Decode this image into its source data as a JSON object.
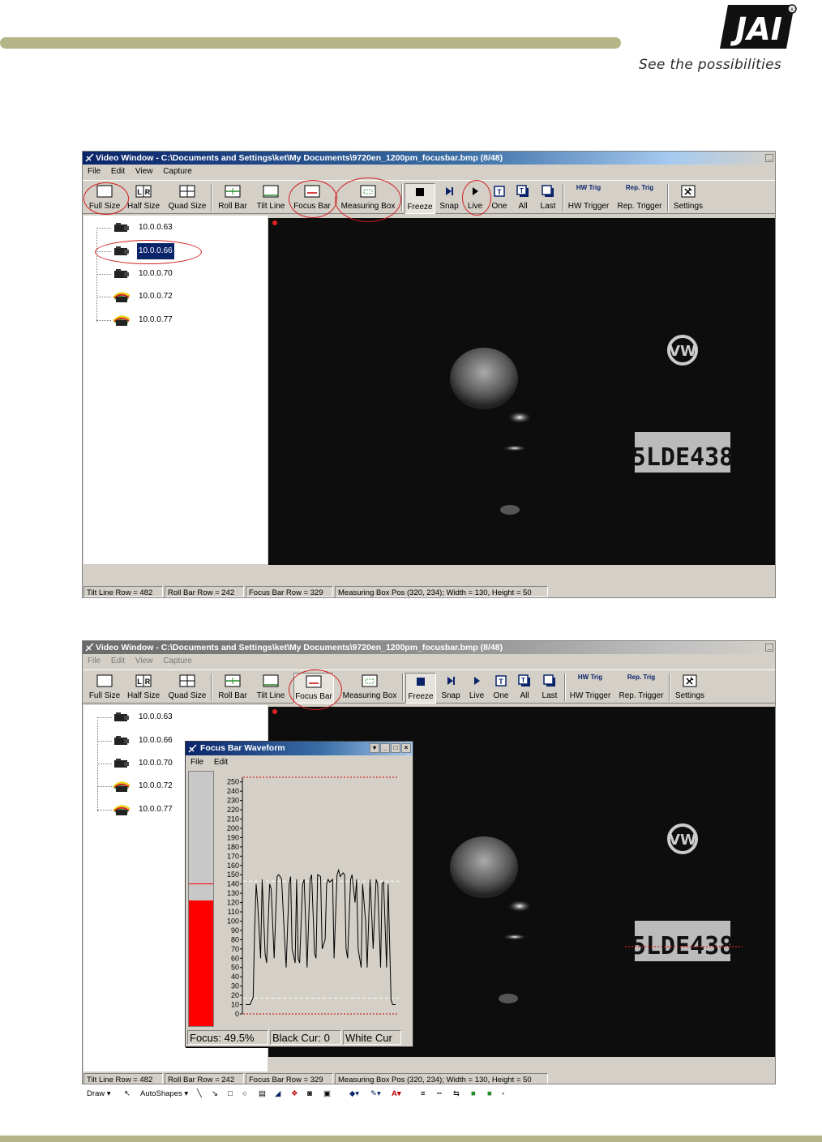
{
  "header": {
    "logo_text": "JAI",
    "tagline": "See the possibilities"
  },
  "window1": {
    "title": "Video Window - C:\\Documents and Settings\\ket\\My Documents\\9720en_1200pm_focusbar.bmp (8/48)",
    "menu": [
      "File",
      "Edit",
      "View",
      "Capture"
    ],
    "toolbar": {
      "full_size": "Full Size",
      "half_size": "Half Size",
      "quad_size": "Quad Size",
      "roll_bar": "Roll Bar",
      "tilt_line": "Tilt Line",
      "focus_bar": "Focus Bar",
      "measuring_box": "Measuring Box",
      "freeze": "Freeze",
      "snap": "Snap",
      "live": "Live",
      "one": "One",
      "all": "All",
      "last": "Last",
      "hw_trigger": "HW Trigger",
      "rep_trigger": "Rep. Trigger",
      "settings": "Settings",
      "hw_icon_text": "HW Trig",
      "rep_icon_text": "Rep. Trig"
    },
    "cameras": [
      "10.0.0.63",
      "10.0.0.66",
      "10.0.0.70",
      "10.0.0.72",
      "10.0.0.77"
    ],
    "selected_camera": "10.0.0.66",
    "status": {
      "tilt_line": "Tilt Line Row = 482",
      "roll_bar": "Roll Bar Row = 242",
      "focus_bar": "Focus Bar Row = 329",
      "measuring_box": "Measuring Box Pos (320, 234); Width = 130, Height = 50"
    }
  },
  "window2": {
    "title": "Video Window - C:\\Documents and Settings\\ket\\My Documents\\9720en_1200pm_focusbar.bmp (8/48)",
    "menu": [
      "File",
      "Edit",
      "View",
      "Capture"
    ],
    "toolbar": {
      "full_size": "Full Size",
      "half_size": "Half Size",
      "quad_size": "Quad Size",
      "roll_bar": "Roll Bar",
      "tilt_line": "Tilt Line",
      "focus_bar": "Focus Bar",
      "measuring_box": "Measuring Box",
      "freeze": "Freeze",
      "snap": "Snap",
      "live": "Live",
      "one": "One",
      "all": "All",
      "last": "Last",
      "hw_trigger": "HW Trigger",
      "rep_trigger": "Rep. Trigger",
      "settings": "Settings",
      "hw_icon_text": "HW Trig",
      "rep_icon_text": "Rep. Trig"
    },
    "cameras": [
      "10.0.0.63",
      "10.0.0.66",
      "10.0.0.70",
      "10.0.0.72",
      "10.0.0.77"
    ],
    "status": {
      "tilt_line": "Tilt Line Row = 482",
      "roll_bar": "Roll Bar Row = 242",
      "focus_bar": "Focus Bar Row = 329",
      "measuring_box": "Measuring Box Pos (320, 234); Width = 130, Height = 50"
    },
    "focus_window": {
      "title": "Focus Bar Waveform",
      "menu": [
        "File",
        "Edit"
      ],
      "focus_text": "Focus: 49.5%",
      "black_text": "Black Cur: 0",
      "white_text": "White Cur",
      "focus_level": 0.495
    }
  },
  "chart_data": {
    "type": "line",
    "title": "",
    "ylim": [
      0,
      255
    ],
    "yticks": [
      0,
      10,
      20,
      30,
      40,
      50,
      60,
      70,
      80,
      90,
      100,
      110,
      120,
      130,
      140,
      150,
      160,
      170,
      180,
      190,
      200,
      210,
      220,
      230,
      240,
      250
    ],
    "reference_lines": {
      "black_level": 17,
      "white_level": 143,
      "upper_limit": 255,
      "lower_limit": 0
    },
    "x": [
      0,
      3,
      5,
      6,
      7,
      8,
      10,
      11,
      13,
      14,
      16,
      17,
      19,
      21,
      22,
      23,
      24,
      26,
      27,
      29,
      30,
      31,
      33,
      34,
      35,
      36,
      38,
      39,
      40,
      41,
      43,
      44,
      46,
      47,
      48,
      50,
      51,
      53,
      54,
      55,
      56,
      58,
      59,
      61,
      62,
      63,
      65,
      66,
      67,
      68,
      70,
      71,
      73,
      74,
      75,
      77,
      78,
      80,
      81,
      83,
      84,
      85,
      87,
      88,
      90,
      91,
      92,
      94,
      95,
      97,
      98,
      100
    ],
    "series": [
      {
        "values": [
          10,
          10,
          18,
          90,
          140,
          120,
          60,
          145,
          65,
          55,
          140,
          135,
          60,
          148,
          150,
          148,
          145,
          80,
          50,
          140,
          148,
          70,
          55,
          145,
          60,
          55,
          140,
          145,
          100,
          50,
          145,
          150,
          65,
          60,
          150,
          148,
          70,
          80,
          140,
          145,
          142,
          145,
          60,
          150,
          155,
          148,
          152,
          150,
          70,
          60,
          145,
          150,
          120,
          145,
          70,
          50,
          140,
          100,
          50,
          145,
          110,
          70,
          145,
          140,
          50,
          140,
          142,
          50,
          140,
          15,
          10,
          10
        ]
      }
    ]
  },
  "draw_toolbar": {
    "draw_label": "Draw",
    "autoshapes_label": "AutoShapes"
  }
}
